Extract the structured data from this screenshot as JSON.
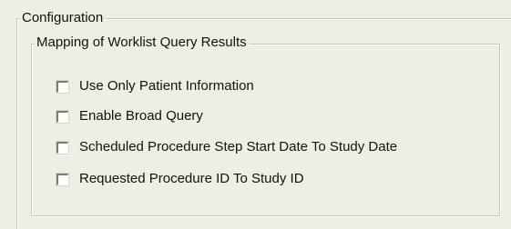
{
  "configuration": {
    "title": "Configuration",
    "mapping_group": {
      "title": "Mapping of Worklist Query Results",
      "options": [
        {
          "label": "Use Only Patient Information",
          "checked": false
        },
        {
          "label": "Enable Broad Query",
          "checked": false
        },
        {
          "label": "Scheduled Procedure Step Start Date To Study Date",
          "checked": false
        },
        {
          "label": "Requested Procedure ID To Study ID",
          "checked": false
        }
      ]
    }
  }
}
